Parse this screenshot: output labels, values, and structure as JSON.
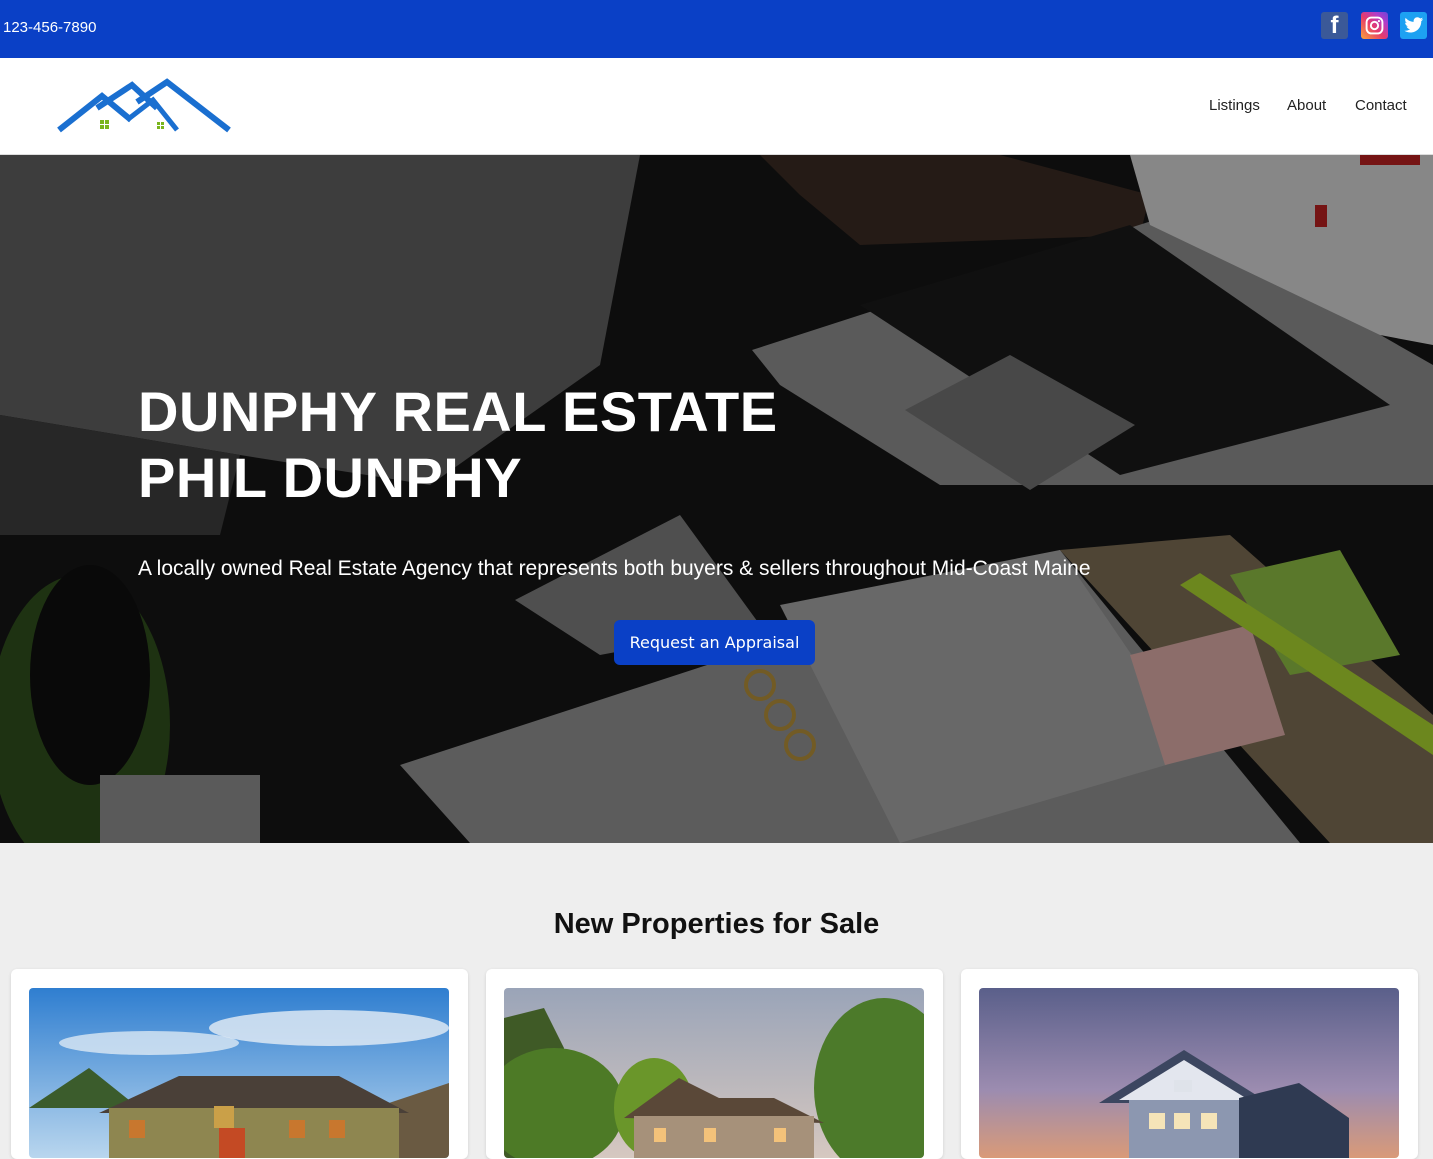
{
  "topbar": {
    "phone": "123-456-7890",
    "social": [
      {
        "name": "facebook",
        "icon": "facebook-icon"
      },
      {
        "name": "instagram",
        "icon": "instagram-icon"
      },
      {
        "name": "twitter",
        "icon": "twitter-icon"
      }
    ]
  },
  "nav": {
    "items": [
      {
        "label": "Listings"
      },
      {
        "label": "About"
      },
      {
        "label": "Contact"
      }
    ]
  },
  "hero": {
    "title_line1": "DUNPHY REAL ESTATE",
    "title_line2": "PHIL DUNPHY",
    "subtitle": "A locally owned Real Estate Agency that represents both buyers & sellers throughout Mid-Coast Maine",
    "button_label": "Request an Appraisal"
  },
  "properties": {
    "heading": "New Properties for Sale"
  },
  "colors": {
    "brand_blue": "#0a40c6",
    "logo_blue": "#1a6fd0",
    "logo_green": "#7ab51d"
  }
}
